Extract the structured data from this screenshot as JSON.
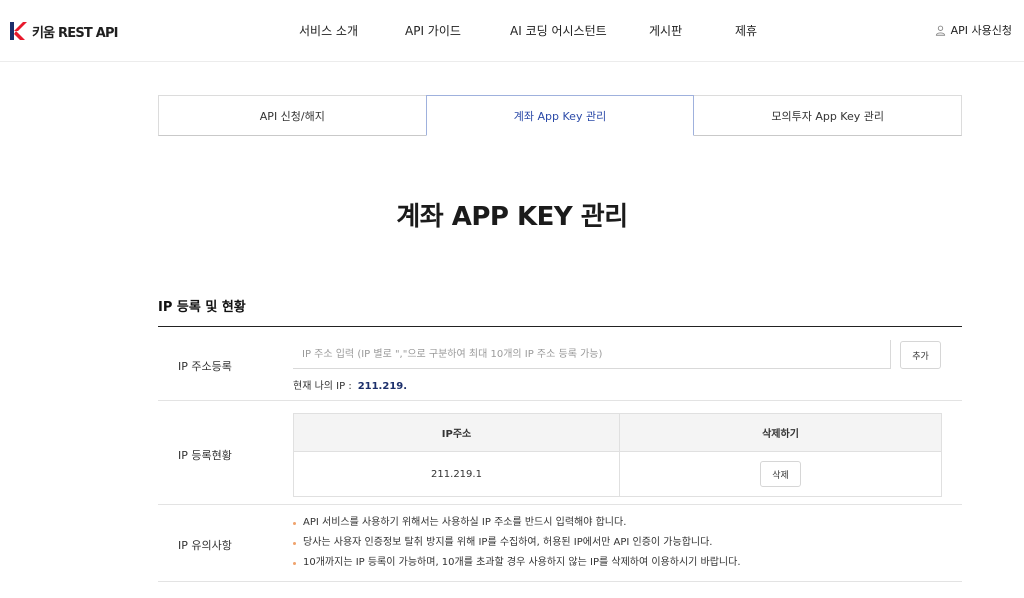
{
  "header": {
    "logo_text": "키움 REST API",
    "nav": [
      "서비스 소개",
      "API 가이드",
      "AI 코딩 어시스턴트",
      "게시판",
      "제휴"
    ],
    "apply_label": "API 사용신청"
  },
  "tabs": [
    {
      "label": "API 신청/해지",
      "active": false
    },
    {
      "label": "계좌 App Key 관리",
      "active": true
    },
    {
      "label": "모의투자 App Key 관리",
      "active": false
    }
  ],
  "page_title": "계좌 APP KEY 관리",
  "section_title": "IP 등록 및 현황",
  "ip_register": {
    "label": "IP 주소등록",
    "placeholder": "IP 주소 입력 (IP 별로 \",\"으로 구분하여 최대 10개의 IP 주소 등록 가능)",
    "add_button": "추가",
    "my_ip_label": "현재 나의 IP :",
    "my_ip_value": "211.219."
  },
  "ip_status": {
    "label": "IP 등록현황",
    "columns": [
      "IP주소",
      "삭제하기"
    ],
    "rows": [
      {
        "ip": "211.219.1",
        "delete_label": "삭제"
      }
    ]
  },
  "ip_notice": {
    "label": "IP 유의사항",
    "items": [
      "API 서비스를 사용하기 위해서는 사용하실 IP 주소를 반드시 입력해야 합니다.",
      "당사는 사용자 인증정보 탈취 방지를 위해 IP를 수집하여, 허용된 IP에서만 API 인증이 가능합니다.",
      "10개까지는 IP 등록이 가능하며, 10개를 초과할 경우 사용하지 않는 IP를 삭제하여 이용하시기 바랍니다."
    ]
  },
  "colors": {
    "brand_red": "#e8192c",
    "brand_navy": "#1c2f6b",
    "active_tab": "#2b4aa8",
    "bullet": "#f0a36e"
  },
  "icons": {
    "logo": "kiwoom-k-logo",
    "user": "user-icon"
  }
}
